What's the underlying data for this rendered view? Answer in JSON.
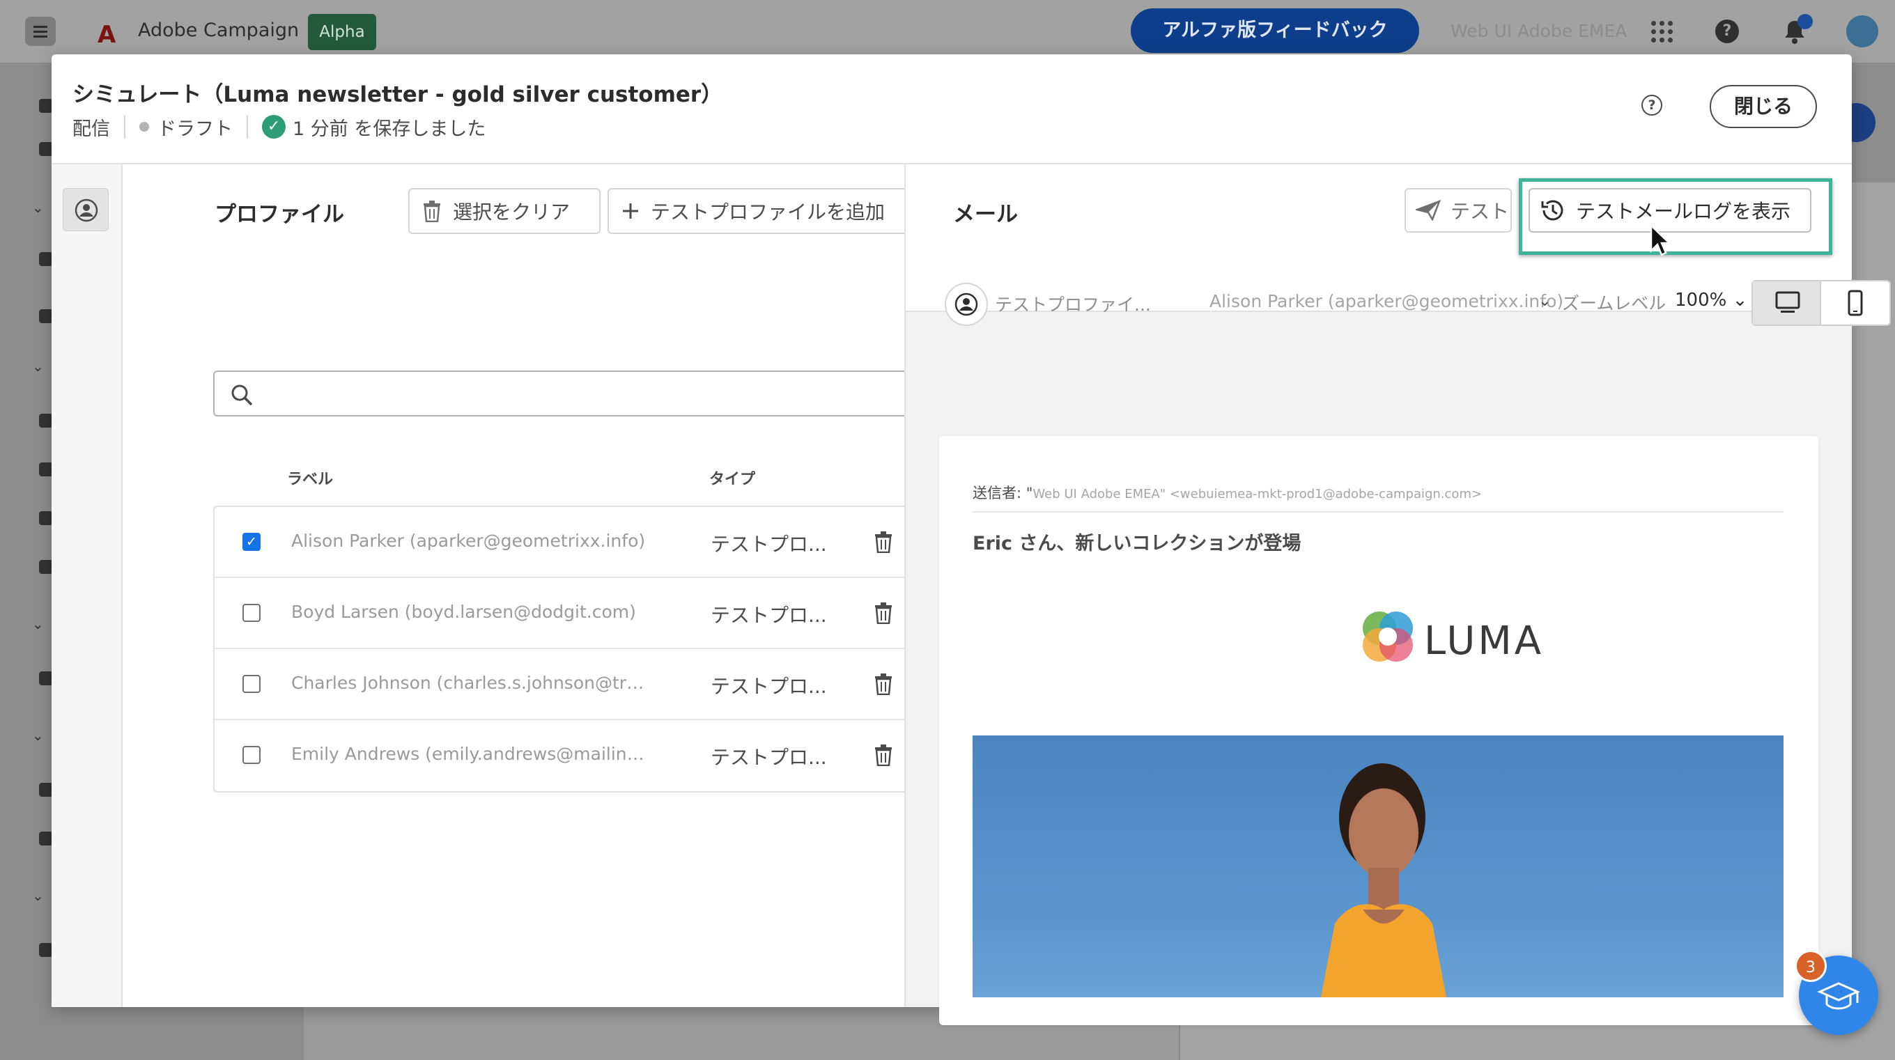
{
  "app": {
    "name": "Adobe Campaign",
    "badge": "Alpha",
    "feedback_button": "アルファ版フィードバック",
    "org_name": "Web UI Adobe EMEA"
  },
  "modal": {
    "title": "シミュレート（Luma newsletter - gold silver customer）",
    "channel": "配信",
    "status": "ドラフト",
    "saved_text": "1 分前 を保存しました",
    "close_label": "閉じる"
  },
  "profiles_panel": {
    "title": "プロファイル",
    "clear_selection": "選択をクリア",
    "add_test_profile": "テストプロファイルを追加",
    "search_placeholder": "",
    "columns": {
      "label": "ラベル",
      "type": "タイプ"
    },
    "rows": [
      {
        "label": "Alison Parker (aparker@geometrixx.info)",
        "type": "テストプロ...",
        "checked": true
      },
      {
        "label": "Boyd Larsen (boyd.larsen@dodgit.com)",
        "type": "テストプロ...",
        "checked": false
      },
      {
        "label": "Charles Johnson (charles.s.johnson@trashy...",
        "type": "テストプロ...",
        "checked": false
      },
      {
        "label": "Emily Andrews (emily.andrews@mailinator....",
        "type": "テストプロ...",
        "checked": false
      }
    ]
  },
  "email_panel": {
    "title": "メール",
    "test_button": "テスト",
    "log_button": "テストメールログを表示",
    "profile_label": "テストプロファイ...",
    "profile_value": "Alison Parker (aparker@geometrixx.info)",
    "zoom_label": "ズームレベル",
    "zoom_value": "100%",
    "sender_prefix": "送信者: \"",
    "sender_value": "Web UI Adobe EMEA\" <webuiemea-mkt-prod1@adobe-campaign.com>",
    "subject": "Eric さん、新しいコレクションが登場",
    "brand": "LUMA"
  },
  "fab": {
    "count": "3"
  },
  "colors": {
    "accent": "#1473e6",
    "highlight": "#3eb39a",
    "success": "#2d9d78",
    "fab": "#2f86e8",
    "badge": "#d9622a"
  }
}
